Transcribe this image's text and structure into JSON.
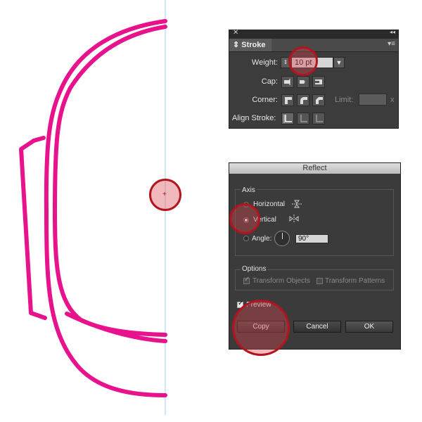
{
  "stroke_panel": {
    "close_glyph": "✕",
    "collapse_glyph": "◂◂",
    "tab_label": "Stroke",
    "menu_glyph": "▾≡",
    "weight_label": "Weight:",
    "weight_value": "10 pt",
    "cap_label": "Cap:",
    "corner_label": "Corner:",
    "limit_label": "Limit:",
    "limit_suffix": "x",
    "align_label": "Align Stroke:"
  },
  "reflect_dialog": {
    "title": "Reflect",
    "axis_label": "Axis",
    "horizontal_label": "Horizontal",
    "vertical_label": "Vertical",
    "vertical_selected": true,
    "angle_label": "Angle:",
    "angle_value": "90°",
    "options_label": "Options",
    "transform_objects_label": "Transform Objects",
    "transform_objects_checked": true,
    "transform_patterns_label": "Transform Patterns",
    "transform_patterns_checked": false,
    "preview_label": "Preview",
    "preview_checked": true,
    "copy_label": "Copy",
    "cancel_label": "Cancel",
    "ok_label": "OK"
  },
  "colors": {
    "stroke_color": "#e8128c",
    "guide_color": "#9fd3ea",
    "highlight_color": "#b3141e"
  }
}
